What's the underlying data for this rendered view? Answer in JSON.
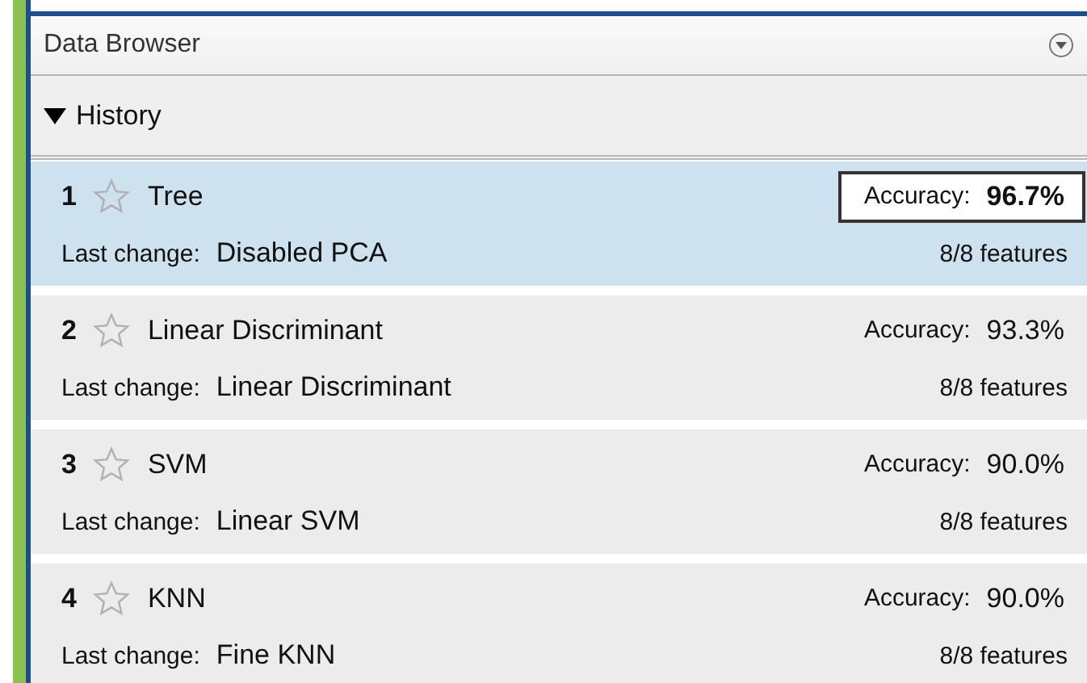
{
  "panel": {
    "title": "Data Browser"
  },
  "section": {
    "label": "History",
    "expanded": true
  },
  "models": [
    {
      "number": "1",
      "starred": false,
      "name": "Tree",
      "last_change_label": "Last change:",
      "last_change": "Disabled PCA",
      "accuracy_label": "Accuracy:",
      "accuracy": "96.7%",
      "features": "8/8 features",
      "selected": true
    },
    {
      "number": "2",
      "starred": false,
      "name": "Linear Discriminant",
      "last_change_label": "Last change:",
      "last_change": "Linear Discriminant",
      "accuracy_label": "Accuracy:",
      "accuracy": "93.3%",
      "features": "8/8 features",
      "selected": false
    },
    {
      "number": "3",
      "starred": false,
      "name": "SVM",
      "last_change_label": "Last change:",
      "last_change": "Linear SVM",
      "accuracy_label": "Accuracy:",
      "accuracy": "90.0%",
      "features": "8/8 features",
      "selected": false
    },
    {
      "number": "4",
      "starred": false,
      "name": "KNN",
      "last_change_label": "Last change:",
      "last_change": "Fine KNN",
      "accuracy_label": "Accuracy:",
      "accuracy": "90.0%",
      "features": "8/8 features",
      "selected": false
    }
  ]
}
